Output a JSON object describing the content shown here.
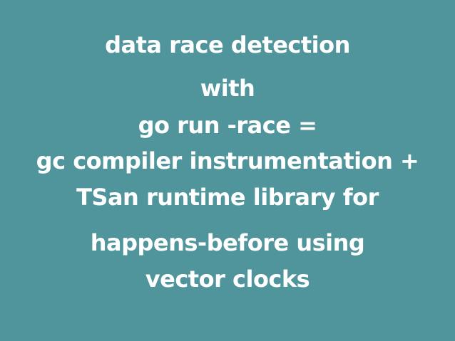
{
  "slide": {
    "background_color": "#4f959b",
    "text_color": "#ffffff",
    "lines": [
      "data race detection",
      "with",
      "go run -race =",
      "gc compiler instrumentation +",
      "TSan runtime library for",
      "happens-before using",
      "vector clocks"
    ]
  }
}
